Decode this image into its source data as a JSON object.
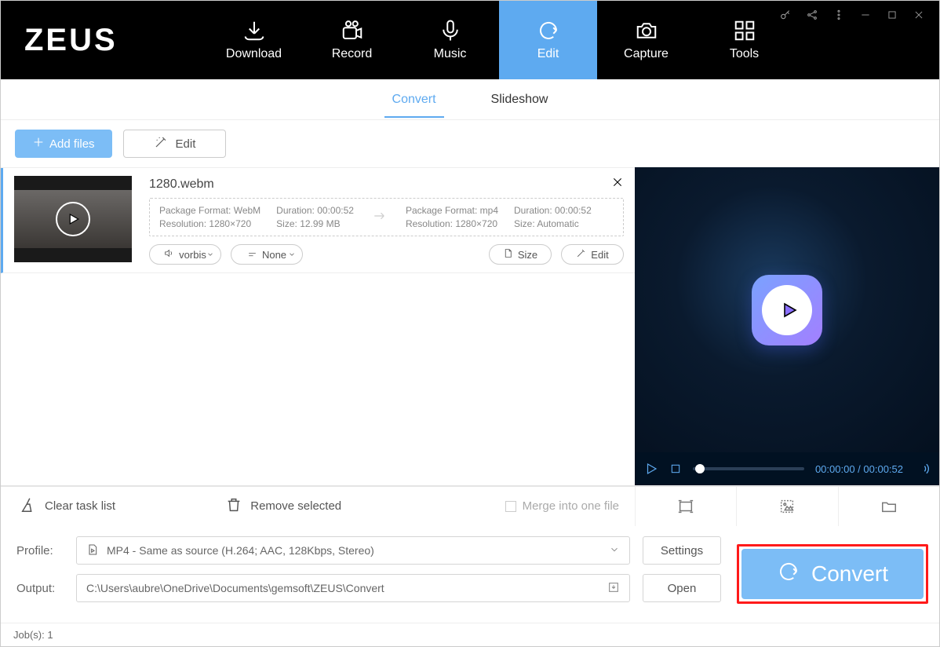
{
  "app": {
    "logo": "ZEUS"
  },
  "nav": [
    {
      "label": "Download"
    },
    {
      "label": "Record"
    },
    {
      "label": "Music"
    },
    {
      "label": "Edit"
    },
    {
      "label": "Capture"
    },
    {
      "label": "Tools"
    }
  ],
  "subtabs": [
    {
      "label": "Convert"
    },
    {
      "label": "Slideshow"
    }
  ],
  "toolbar": {
    "add_files": "Add files",
    "edit": "Edit"
  },
  "file": {
    "name": "1280.webm",
    "src": {
      "format_label": "Package Format:",
      "format": "WebM",
      "resolution_label": "Resolution:",
      "resolution": "1280×720",
      "duration_label": "Duration:",
      "duration": "00:00:52",
      "size_label": "Size:",
      "size": "12.99 MB"
    },
    "dst": {
      "format_label": "Package Format:",
      "format": "mp4",
      "resolution_label": "Resolution:",
      "resolution": "1280×720",
      "duration_label": "Duration:",
      "duration": "00:00:52",
      "size_label": "Size:",
      "size": "Automatic"
    },
    "pills": {
      "audio": "vorbis",
      "subtitle": "None",
      "size": "Size",
      "edit": "Edit"
    }
  },
  "player": {
    "timecode": "00:00:00 / 00:00:52"
  },
  "bottom": {
    "clear": "Clear task list",
    "remove": "Remove selected",
    "merge": "Merge into one file"
  },
  "form": {
    "profile_label": "Profile:",
    "profile_value": "MP4 - Same as source (H.264; AAC, 128Kbps, Stereo)",
    "output_label": "Output:",
    "output_value": "C:\\Users\\aubre\\OneDrive\\Documents\\gemsoft\\ZEUS\\Convert",
    "settings": "Settings",
    "open": "Open",
    "convert": "Convert"
  },
  "status": {
    "jobs": "Job(s): 1"
  }
}
